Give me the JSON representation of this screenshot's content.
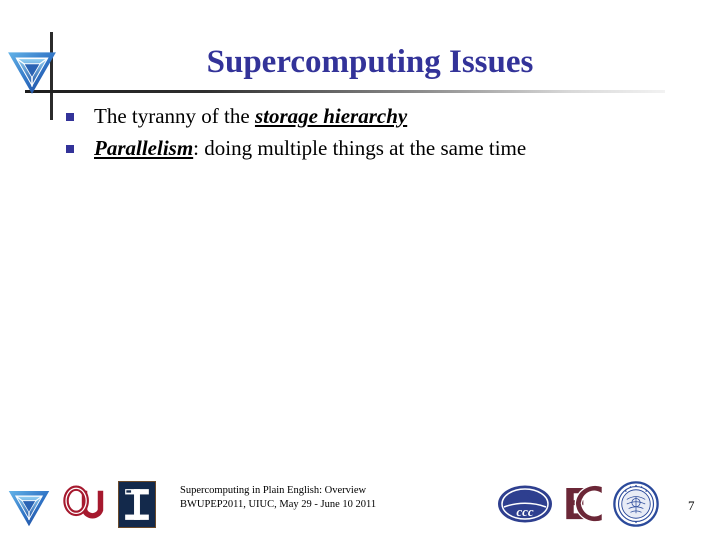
{
  "slide": {
    "title": "Supercomputing Issues",
    "title_color": "#333399",
    "bullets": [
      {
        "prefix": "The tyranny of the ",
        "emphasis": "storage hierarchy",
        "suffix": ""
      },
      {
        "prefix": "",
        "emphasis": "Parallelism",
        "suffix": ": doing multiple things at the same time"
      }
    ],
    "bullet_marker_color": "#333399"
  },
  "footer": {
    "line1": "Supercomputing in Plain English: Overview",
    "line2": "BWUPEP2011, UIUC, May 29 - June 10 2011",
    "page_number": "7",
    "logos": [
      {
        "name": "oscer-pyramid-logo",
        "text": ""
      },
      {
        "name": "ou-logo",
        "text": "OU",
        "color": "#a6192e"
      },
      {
        "name": "illinois-logo",
        "text": "I",
        "color": "#13294b"
      },
      {
        "name": "ccc-logo",
        "text": "ccc",
        "color": "#2e3f8f"
      },
      {
        "name": "earlham-ec-logo",
        "text": "EC",
        "color": "#6b2737"
      },
      {
        "name": "university-seal-logo",
        "text": "",
        "color": "#2b4a9b"
      }
    ]
  },
  "header": {
    "logo_name": "oscer-pyramid-logo"
  }
}
